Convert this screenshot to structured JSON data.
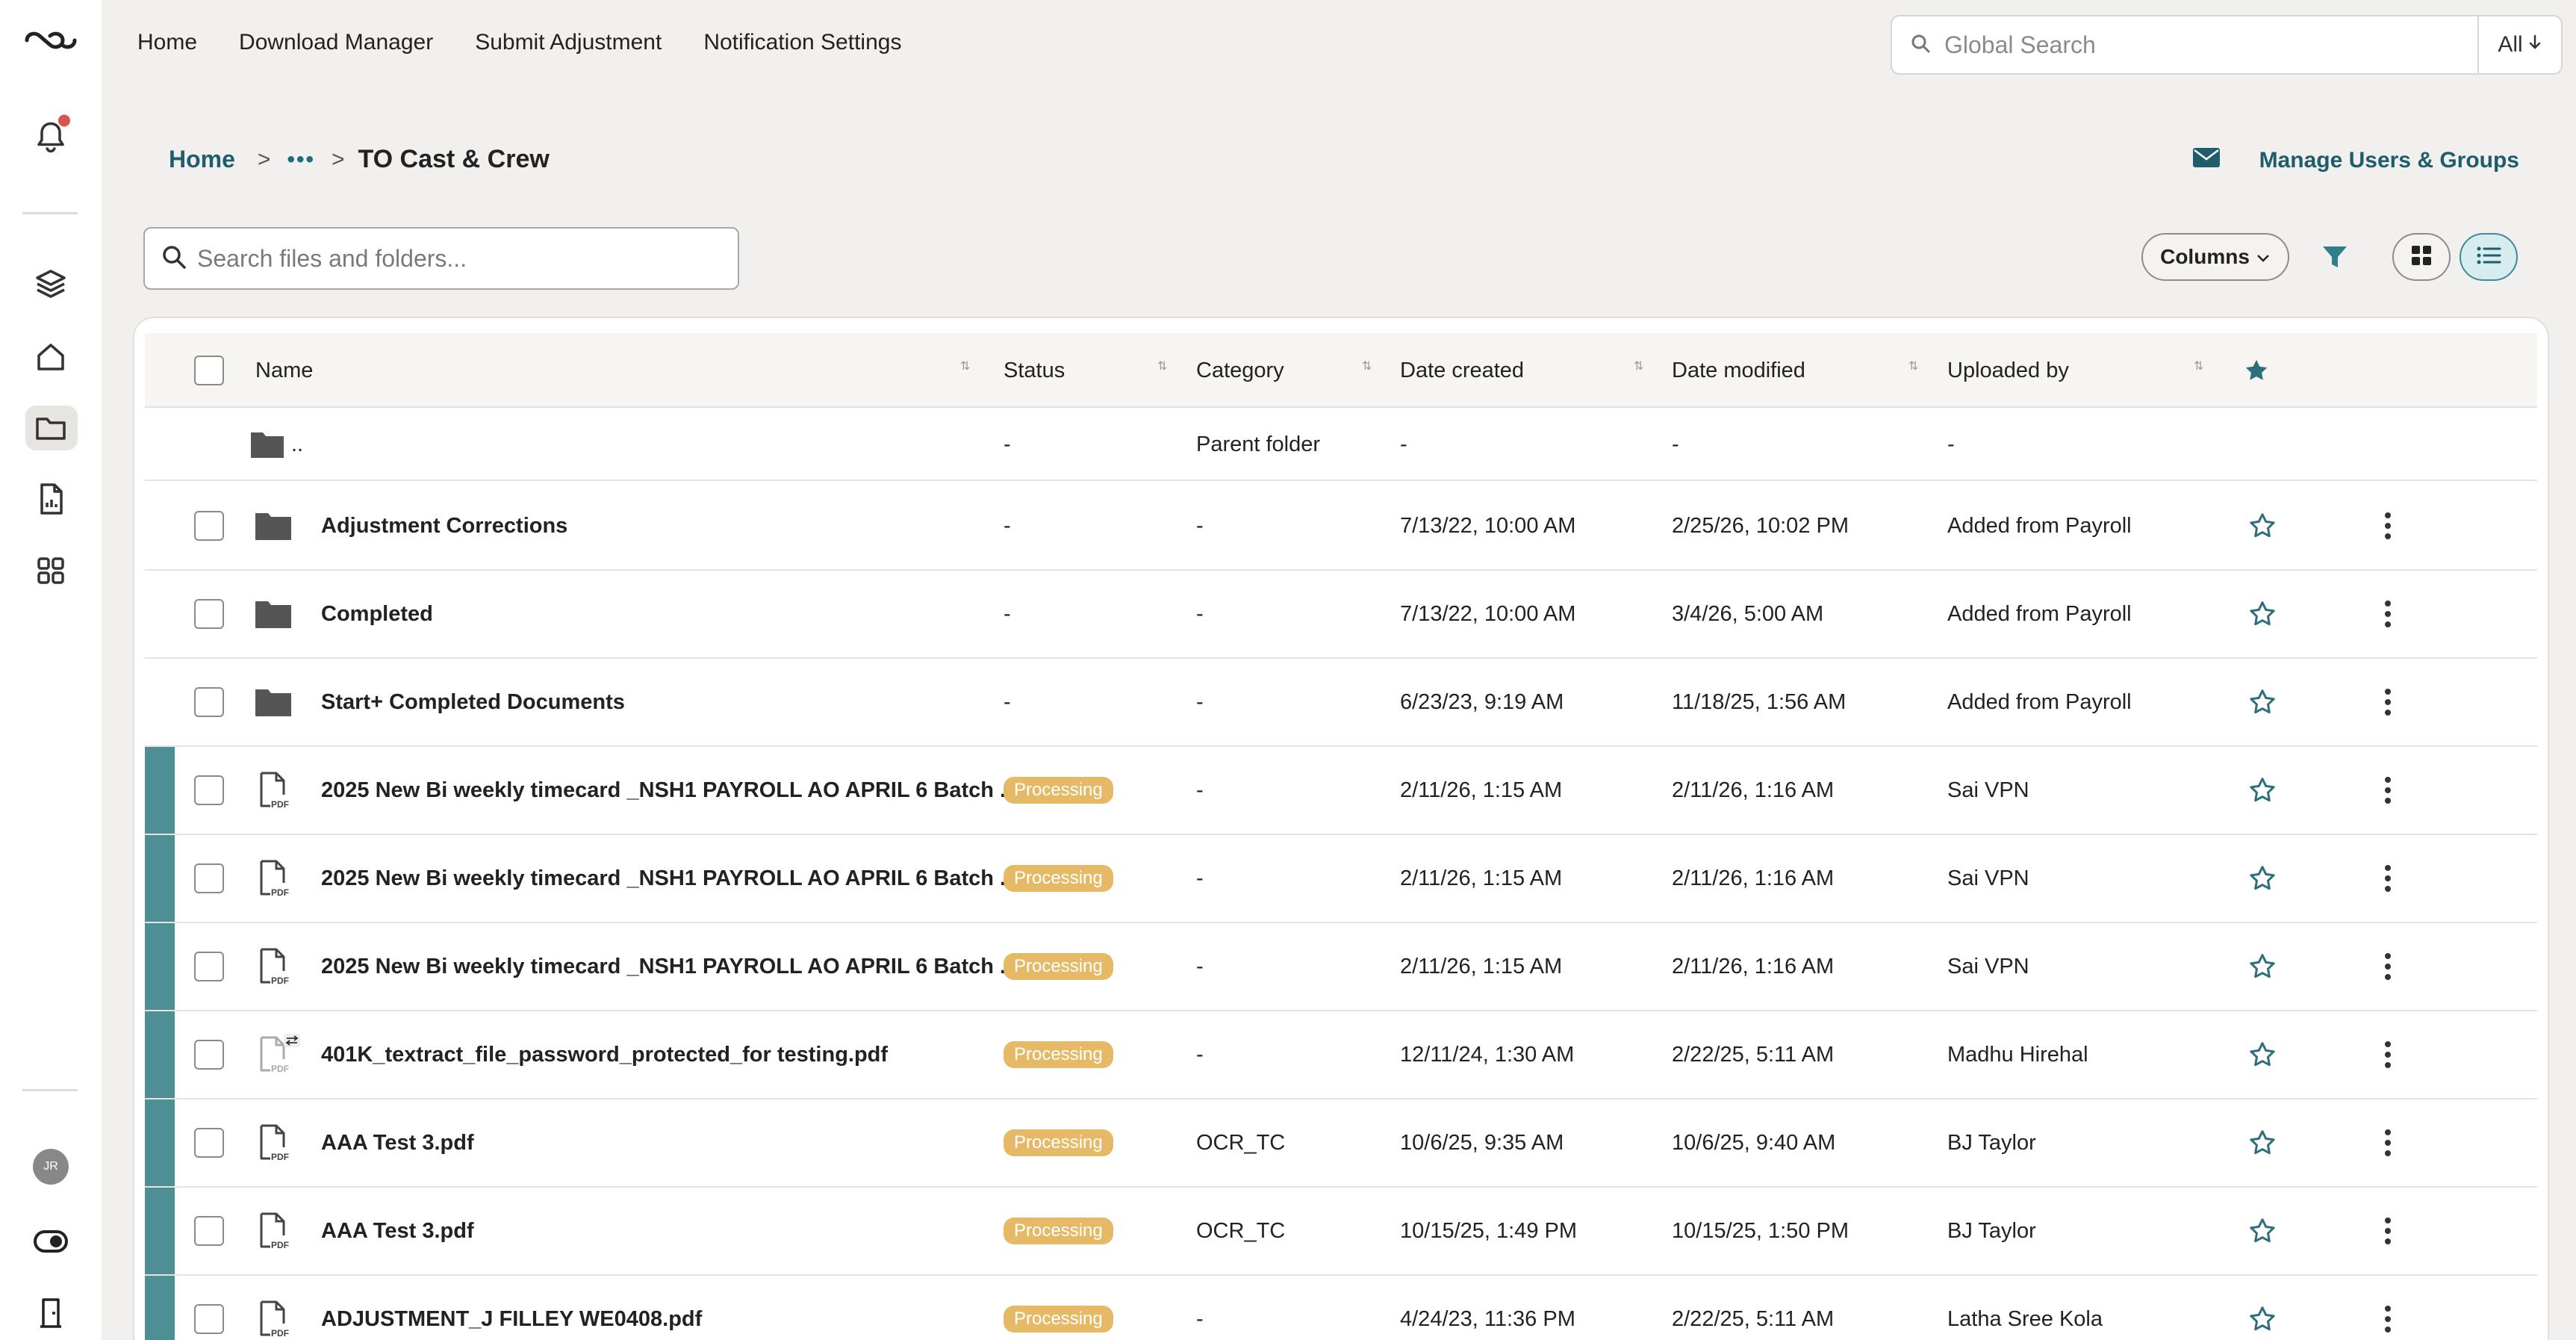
{
  "nav": {
    "items": [
      "Home",
      "Download Manager",
      "Submit Adjustment",
      "Notification Settings"
    ]
  },
  "search": {
    "global_placeholder": "Global Search",
    "scope_label": "All",
    "files_placeholder": "Search files and folders..."
  },
  "breadcrumb": {
    "home": "Home",
    "ellipsis": "•••",
    "current": "TO Cast & Crew"
  },
  "header": {
    "manage_label": "Manage Users & Groups"
  },
  "toolbar": {
    "columns_label": "Columns"
  },
  "user": {
    "initials": "JR"
  },
  "table": {
    "columns": [
      "Name",
      "Status",
      "Category",
      "Date created",
      "Date modified",
      "Uploaded by"
    ],
    "parent_row": {
      "name": "..",
      "status": "-",
      "category": "Parent folder",
      "created": "-",
      "modified": "-",
      "uploaded_by": "-"
    },
    "rows": [
      {
        "type": "folder",
        "name": "Adjustment Corrections",
        "status": "-",
        "category": "-",
        "created": "7/13/22, 10:00 AM",
        "modified": "2/25/26, 10:02 PM",
        "uploaded_by": "Added from Payroll",
        "marker": false
      },
      {
        "type": "folder",
        "name": "Completed",
        "status": "-",
        "category": "-",
        "created": "7/13/22, 10:00 AM",
        "modified": "3/4/26, 5:00 AM",
        "uploaded_by": "Added from Payroll",
        "marker": false
      },
      {
        "type": "folder",
        "name": "Start+ Completed Documents",
        "status": "-",
        "category": "-",
        "created": "6/23/23, 9:19 AM",
        "modified": "11/18/25, 1:56 AM",
        "uploaded_by": "Added from Payroll",
        "marker": false
      },
      {
        "type": "pdf",
        "name": "2025 New Bi weekly timecard _NSH1 PAYROLL AO APRIL 6 Batch ...",
        "status": "Processing",
        "category": "-",
        "created": "2/11/26, 1:15 AM",
        "modified": "2/11/26, 1:16 AM",
        "uploaded_by": "Sai VPN",
        "marker": true
      },
      {
        "type": "pdf",
        "name": "2025 New Bi weekly timecard _NSH1 PAYROLL AO APRIL 6 Batch ...",
        "status": "Processing",
        "category": "-",
        "created": "2/11/26, 1:15 AM",
        "modified": "2/11/26, 1:16 AM",
        "uploaded_by": "Sai VPN",
        "marker": true
      },
      {
        "type": "pdf",
        "name": "2025 New Bi weekly timecard _NSH1 PAYROLL AO APRIL 6 Batch ...",
        "status": "Processing",
        "category": "-",
        "created": "2/11/26, 1:15 AM",
        "modified": "2/11/26, 1:16 AM",
        "uploaded_by": "Sai VPN",
        "marker": true
      },
      {
        "type": "pdf-locked",
        "name": "401K_textract_file_password_protected_for testing.pdf",
        "status": "Processing",
        "category": "-",
        "created": "12/11/24, 1:30 AM",
        "modified": "2/22/25, 5:11 AM",
        "uploaded_by": "Madhu Hirehal",
        "marker": true
      },
      {
        "type": "pdf",
        "name": "AAA Test 3.pdf",
        "status": "Processing",
        "category": "OCR_TC",
        "created": "10/6/25, 9:35 AM",
        "modified": "10/6/25, 9:40 AM",
        "uploaded_by": "BJ Taylor",
        "marker": true
      },
      {
        "type": "pdf",
        "name": "AAA Test 3.pdf",
        "status": "Processing",
        "category": "OCR_TC",
        "created": "10/15/25, 1:49 PM",
        "modified": "10/15/25, 1:50 PM",
        "uploaded_by": "BJ Taylor",
        "marker": true
      },
      {
        "type": "pdf",
        "name": "ADJUSTMENT_J FILLEY WE0408.pdf",
        "status": "Processing",
        "category": "-",
        "created": "4/24/23, 11:36 PM",
        "modified": "2/22/25, 5:11 AM",
        "uploaded_by": "Latha Sree Kola",
        "marker": true
      }
    ]
  },
  "colors": {
    "accent": "#1f5d6b",
    "marker": "#4e8f96",
    "badge": "#e6b966",
    "notification": "#d9534f"
  },
  "icons": [
    "logo-icon",
    "bell-icon",
    "layers-icon",
    "home-icon",
    "folder-icon",
    "report-icon",
    "apps-icon",
    "toggle-icon",
    "exit-icon",
    "search-icon",
    "envelope-icon",
    "filter-icon",
    "grid-view-icon",
    "list-view-icon",
    "star-icon",
    "kebab-icon",
    "pdf-icon",
    "sort-icon"
  ]
}
